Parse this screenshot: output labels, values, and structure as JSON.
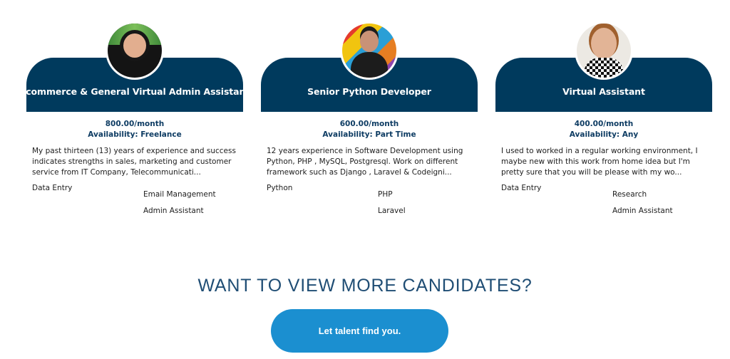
{
  "candidates": [
    {
      "title": "Ecommerce & General Virtual Admin Assistant",
      "price": "800.00/month",
      "availability": "Availability: Freelance",
      "description": "My past thirteen (13) years of experience and success indicates strengths in sales, marketing and customer service from IT Company, Telecommunicati...",
      "skills": [
        "Data Entry",
        "Email Management",
        "Admin Assistant"
      ]
    },
    {
      "title": "Senior Python Developer",
      "price": "600.00/month",
      "availability": "Availability: Part Time",
      "description": "12 years experience in Software Development using Python, PHP , MySQL, Postgresql. Work on different framework such as Django , Laravel & Codeigni...",
      "skills": [
        "Python",
        "PHP",
        "Laravel"
      ]
    },
    {
      "title": "Virtual Assistant",
      "price": "400.00/month",
      "availability": "Availability: Any",
      "description": "I used to worked in a regular working environment, I maybe new with this work from home idea but I'm pretty sure that you will be please with my wo...",
      "skills": [
        "Data Entry",
        "Research",
        "Admin Assistant"
      ]
    }
  ],
  "cta": {
    "heading": "WANT TO VIEW MORE CANDIDATES?",
    "button_label": "Let talent find you."
  },
  "colors": {
    "banner": "#003a5d",
    "accent_text": "#0e3c63",
    "button": "#1b8fd0"
  }
}
